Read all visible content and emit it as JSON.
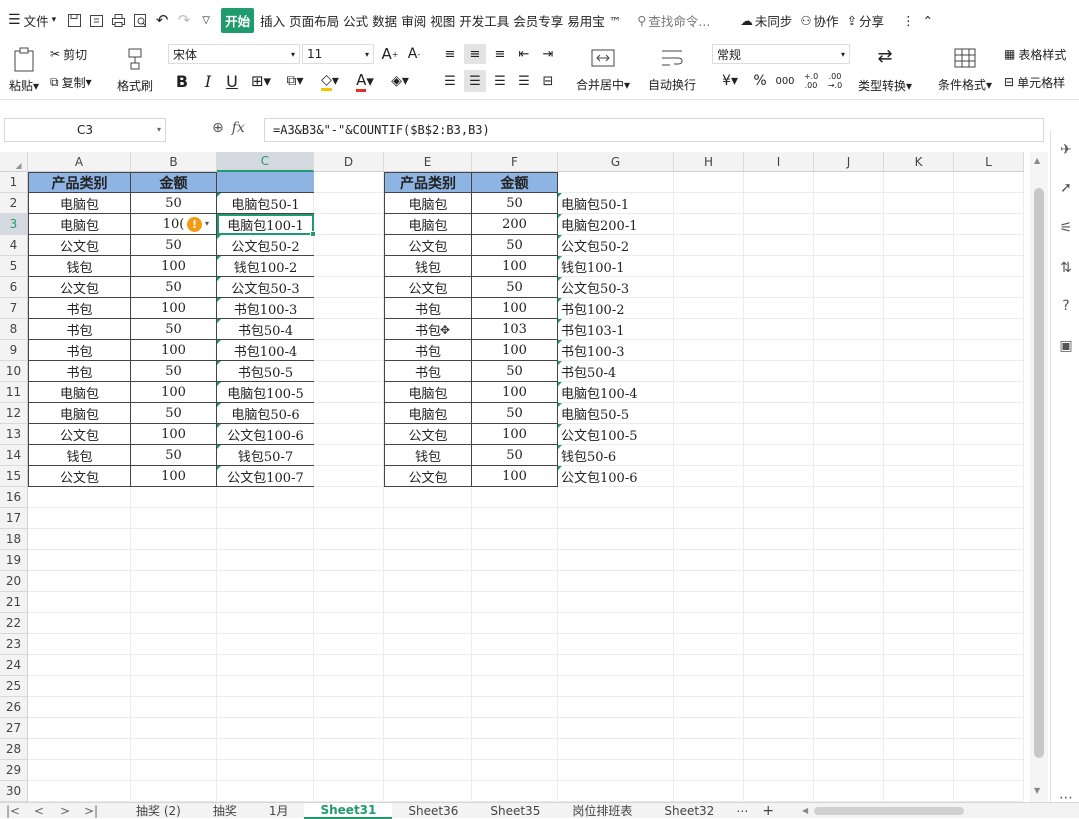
{
  "menu": {
    "file_label": "文件",
    "tabs": [
      "开始",
      "插入",
      "页面布局",
      "公式",
      "数据",
      "审阅",
      "视图",
      "开发工具",
      "会员专享",
      "易用宝 ™"
    ],
    "search_placeholder": "查找命令...",
    "sync_label": "未同步",
    "collab_label": "协作",
    "share_label": "分享"
  },
  "ribbon": {
    "paste": "粘贴",
    "cut": "剪切",
    "copy": "复制",
    "format_painter": "格式刷",
    "font_name": "宋体",
    "font_size": "11",
    "bold": "B",
    "italic": "I",
    "underline": "U",
    "merge_center": "合并居中",
    "wrap_text": "自动换行",
    "number_format": "常规",
    "currency": "¥",
    "percent": "%",
    "thousands": "000",
    "inc_decimal": "+.0 .00",
    "dec_decimal": ".00 →.0",
    "type_convert": "类型转换",
    "cond_format": "条件格式",
    "table_style": "表格样式",
    "cell_style": "单元格样"
  },
  "formula_bar": {
    "cell_ref": "C3",
    "fx": "fx",
    "formula": "=A3&B3&\"-\"&COUNTIF($B$2:B3,B3)"
  },
  "columns": [
    "A",
    "B",
    "C",
    "D",
    "E",
    "F",
    "G",
    "H",
    "I",
    "J",
    "K",
    "L"
  ],
  "rows": [
    "1",
    "2",
    "3",
    "4",
    "5",
    "6",
    "7",
    "8",
    "9",
    "10",
    "11",
    "12",
    "13",
    "14",
    "15",
    "16",
    "17",
    "18",
    "19",
    "20",
    "21",
    "22",
    "23",
    "24",
    "25",
    "26",
    "27",
    "28",
    "29",
    "30"
  ],
  "selected_cell": "C3",
  "table1": {
    "headers": [
      "产品类别",
      "金额"
    ],
    "rows": [
      [
        "电脑包",
        "50",
        "电脑包50-1"
      ],
      [
        "电脑包",
        "10(",
        "电脑包100-1"
      ],
      [
        "公文包",
        "50",
        "公文包50-2"
      ],
      [
        "钱包",
        "100",
        "钱包100-2"
      ],
      [
        "公文包",
        "50",
        "公文包50-3"
      ],
      [
        "书包",
        "100",
        "书包100-3"
      ],
      [
        "书包",
        "50",
        "书包50-4"
      ],
      [
        "书包",
        "100",
        "书包100-4"
      ],
      [
        "书包",
        "50",
        "书包50-5"
      ],
      [
        "电脑包",
        "100",
        "电脑包100-5"
      ],
      [
        "电脑包",
        "50",
        "电脑包50-6"
      ],
      [
        "公文包",
        "100",
        "公文包100-6"
      ],
      [
        "钱包",
        "50",
        "钱包50-7"
      ],
      [
        "公文包",
        "100",
        "公文包100-7"
      ]
    ]
  },
  "table2": {
    "headers": [
      "产品类别",
      "金额"
    ],
    "rows": [
      [
        "电脑包",
        "50",
        "电脑包50-1"
      ],
      [
        "电脑包",
        "200",
        "电脑包200-1"
      ],
      [
        "公文包",
        "50",
        "公文包50-2"
      ],
      [
        "钱包",
        "100",
        "钱包100-1"
      ],
      [
        "公文包",
        "50",
        "公文包50-3"
      ],
      [
        "书包",
        "100",
        "书包100-2"
      ],
      [
        "书包",
        "103",
        "书包103-1"
      ],
      [
        "书包",
        "100",
        "书包100-3"
      ],
      [
        "书包",
        "50",
        "书包50-4"
      ],
      [
        "电脑包",
        "100",
        "电脑包100-4"
      ],
      [
        "电脑包",
        "50",
        "电脑包50-5"
      ],
      [
        "公文包",
        "100",
        "公文包100-5"
      ],
      [
        "钱包",
        "50",
        "钱包50-6"
      ],
      [
        "公文包",
        "100",
        "公文包100-6"
      ]
    ]
  },
  "sheets": [
    "抽奖 (2)",
    "抽奖",
    "1月",
    "Sheet31",
    "Sheet36",
    "Sheet35",
    "岗位排班表",
    "Sheet32"
  ],
  "active_sheet": "Sheet31",
  "colors": {
    "accent": "#1f9b6d",
    "header_fill": "#8db4e2"
  }
}
